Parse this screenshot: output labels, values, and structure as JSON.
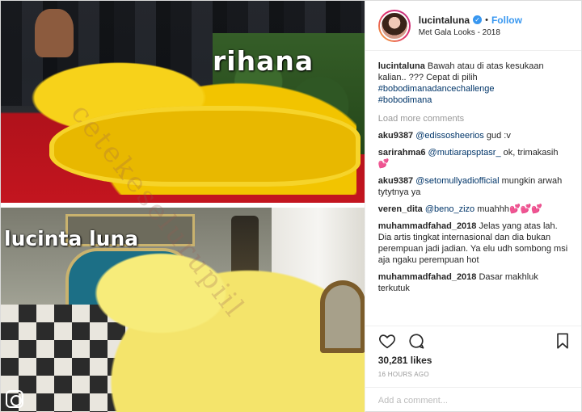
{
  "image": {
    "top_label": "rihana",
    "bottom_label": "lucinta luna",
    "watermark": "cetekeselurupiil"
  },
  "header": {
    "username": "lucintaluna",
    "verified_mark": "✓",
    "separator": "•",
    "follow_label": "Follow",
    "location": "Met Gala Looks - 2018"
  },
  "caption": {
    "username": "lucintaluna",
    "text": "Bawah atau di atas kesukaan kalian.. ??? Cepat di pilih",
    "hashtags": [
      "#bobodimanadancechallenge",
      "#bobodimana"
    ]
  },
  "load_more": "Load more comments",
  "comments": [
    {
      "user": "aku9387",
      "mention": "@edissosheerios",
      "text": " gud :v",
      "hearts": ""
    },
    {
      "user": "sarirahma6",
      "mention": "@mutiarapsptasr_",
      "text": " ok, trimakasih ",
      "hearts": "💕"
    },
    {
      "user": "aku9387",
      "mention": "@setomullyadiofficial",
      "text": " mungkin arwah tytytnya ya",
      "hearts": ""
    },
    {
      "user": "veren_dita",
      "mention": "@beno_zizo",
      "text": " muahhh",
      "hearts": "💕💕💕"
    },
    {
      "user": "muhammadfahad_2018",
      "mention": "",
      "text": "Jelas yang atas lah. Dia artis tingkat internasional dan dia bukan perempuan jadi jadian. Ya elu udh sombong msi aja ngaku perempuan hot",
      "hearts": ""
    },
    {
      "user": "muhammadfahad_2018",
      "mention": "",
      "text": "Dasar makhluk terkutuk",
      "hearts": ""
    }
  ],
  "likes": "30,281 likes",
  "time": "16 HOURS AGO",
  "add_comment_placeholder": "Add a comment...",
  "colors": {
    "link": "#3897f0",
    "hashtag": "#003569",
    "muted": "#999999",
    "gown_yellow": "#f2c400",
    "carpet_red": "#c3151f"
  },
  "icons": [
    "heart-outline-icon",
    "comment-bubble-icon",
    "bookmark-icon",
    "verified-icon",
    "instagram-logo-icon"
  ]
}
